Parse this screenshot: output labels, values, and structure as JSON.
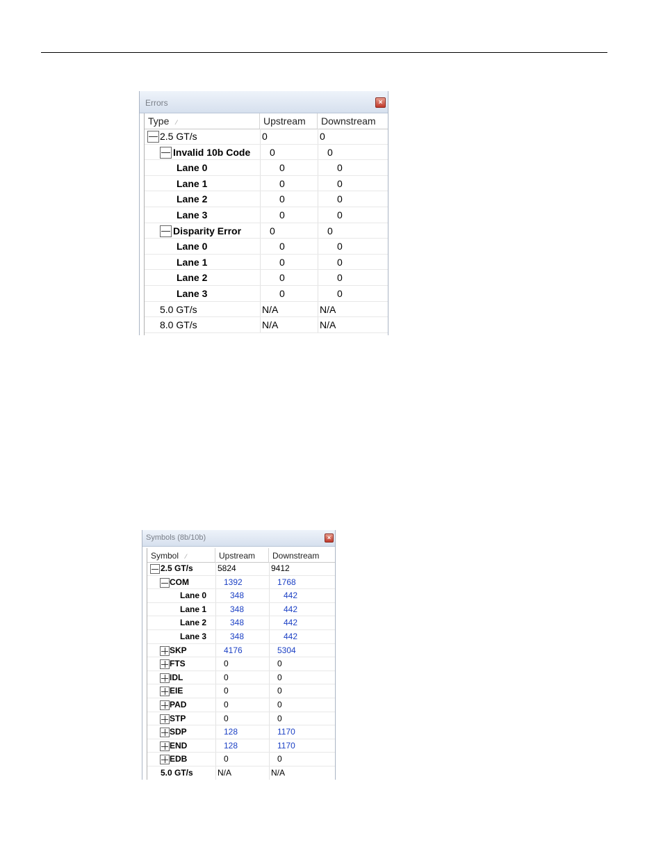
{
  "errors_panel": {
    "title": "Errors",
    "close_glyph": "×",
    "columns": [
      "Type",
      "Upstream",
      "Downstream"
    ],
    "rows": [
      {
        "label": "2.5 GT/s",
        "up": "0",
        "down": "0",
        "level": 0,
        "expander": "minus"
      },
      {
        "label": "Invalid 10b Code",
        "up": "0",
        "down": "0",
        "level": 1,
        "expander": "minus"
      },
      {
        "label": "Lane 0",
        "up": "0",
        "down": "0",
        "level": 2,
        "expander": "none"
      },
      {
        "label": "Lane 1",
        "up": "0",
        "down": "0",
        "level": 2,
        "expander": "none"
      },
      {
        "label": "Lane 2",
        "up": "0",
        "down": "0",
        "level": 2,
        "expander": "none"
      },
      {
        "label": "Lane 3",
        "up": "0",
        "down": "0",
        "level": 2,
        "expander": "none"
      },
      {
        "label": "Disparity Error",
        "up": "0",
        "down": "0",
        "level": 1,
        "expander": "minus"
      },
      {
        "label": "Lane 0",
        "up": "0",
        "down": "0",
        "level": 2,
        "expander": "none"
      },
      {
        "label": "Lane 1",
        "up": "0",
        "down": "0",
        "level": 2,
        "expander": "none"
      },
      {
        "label": "Lane 2",
        "up": "0",
        "down": "0",
        "level": 2,
        "expander": "none"
      },
      {
        "label": "Lane 3",
        "up": "0",
        "down": "0",
        "level": 2,
        "expander": "none"
      },
      {
        "label": "5.0 GT/s",
        "up": "N/A",
        "down": "N/A",
        "level": 0,
        "expander": "none"
      },
      {
        "label": "8.0 GT/s",
        "up": "N/A",
        "down": "N/A",
        "level": 0,
        "expander": "none"
      }
    ]
  },
  "symbols_panel": {
    "title": "Symbols (8b/10b)",
    "close_glyph": "×",
    "columns": [
      "Symbol",
      "Upstream",
      "Downstream"
    ],
    "rows": [
      {
        "label": "2.5 GT/s",
        "up": "5824",
        "down": "9412",
        "level": 0,
        "expander": "minus",
        "blue": false
      },
      {
        "label": "COM",
        "up": "1392",
        "down": "1768",
        "level": 1,
        "expander": "minus",
        "blue": true
      },
      {
        "label": "Lane 0",
        "up": "348",
        "down": "442",
        "level": 2,
        "expander": "none",
        "blue": true
      },
      {
        "label": "Lane 1",
        "up": "348",
        "down": "442",
        "level": 2,
        "expander": "none",
        "blue": true
      },
      {
        "label": "Lane 2",
        "up": "348",
        "down": "442",
        "level": 2,
        "expander": "none",
        "blue": true
      },
      {
        "label": "Lane 3",
        "up": "348",
        "down": "442",
        "level": 2,
        "expander": "none",
        "blue": true
      },
      {
        "label": "SKP",
        "up": "4176",
        "down": "5304",
        "level": 1,
        "expander": "plus",
        "blue": true
      },
      {
        "label": "FTS",
        "up": "0",
        "down": "0",
        "level": 1,
        "expander": "plus",
        "blue": false
      },
      {
        "label": "IDL",
        "up": "0",
        "down": "0",
        "level": 1,
        "expander": "plus",
        "blue": false
      },
      {
        "label": "EIE",
        "up": "0",
        "down": "0",
        "level": 1,
        "expander": "plus",
        "blue": false
      },
      {
        "label": "PAD",
        "up": "0",
        "down": "0",
        "level": 1,
        "expander": "plus",
        "blue": false
      },
      {
        "label": "STP",
        "up": "0",
        "down": "0",
        "level": 1,
        "expander": "plus",
        "blue": false
      },
      {
        "label": "SDP",
        "up": "128",
        "down": "1170",
        "level": 1,
        "expander": "plus",
        "blue": true
      },
      {
        "label": "END",
        "up": "128",
        "down": "1170",
        "level": 1,
        "expander": "plus",
        "blue": true
      },
      {
        "label": "EDB",
        "up": "0",
        "down": "0",
        "level": 1,
        "expander": "plus",
        "blue": false
      },
      {
        "label": "5.0 GT/s",
        "up": "N/A",
        "down": "N/A",
        "level": 0,
        "expander": "none",
        "blue": false
      }
    ]
  },
  "colors": {
    "value_blue": "#1a3fc4",
    "titlebar": "#d6e0ee",
    "close_red": "#c0392b"
  },
  "icons": {
    "expanded": "minus-box-icon",
    "collapsed": "plus-box-icon",
    "sort": "sort-indicator-icon",
    "close": "close-icon"
  }
}
